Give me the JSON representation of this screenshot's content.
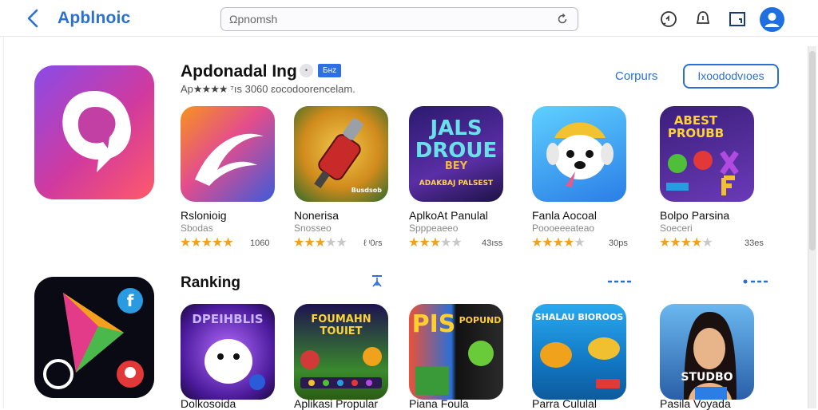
{
  "header": {
    "brand": "Αpblnoic",
    "search_placeholder": "Ωpnomsh"
  },
  "featured": {
    "title": "Apdonadal Ing",
    "badge_gray": "•",
    "badge_blue": "Бнz",
    "subtitle_prefix": "Ap",
    "subtitle_stars": "★★★★",
    "subtitle_rest": "⁷ıs 3060 ɛocodoorencelam.",
    "compare_link": "Corpurs",
    "action_button": "Ixoododvıoes"
  },
  "row1": [
    {
      "name": "Rslonioig",
      "category": "Sbodas",
      "rating": 5,
      "count": "1060"
    },
    {
      "name": "Nonerisa",
      "category": "Snosseo",
      "rating": 3,
      "count": "ℓ ᶦ0ɾs",
      "tile_text": "Busdsob"
    },
    {
      "name": "AplkoAt Panulal",
      "category": "Spppeaeeo",
      "rating": 3,
      "count": "43ıss",
      "tile_text": "JALS DROUE",
      "tile_text2": "BEY",
      "tile_text3": "ADAKBAJ PALSEST"
    },
    {
      "name": "Fanla Aocoal",
      "category": "Poooeeeateao",
      "rating": 4,
      "count": "30ps"
    },
    {
      "name": "Bolpo Parsina",
      "category": "Soeceri",
      "rating": 4,
      "count": "33es",
      "tile_text": "ABEST PROUBB"
    }
  ],
  "ranking": {
    "title": "Ranking"
  },
  "row2": [
    {
      "name": "Dolkosoida",
      "tile_text": "DPEIHBLIS"
    },
    {
      "name": "Aplikasi Propular",
      "tile_text": "FOUMAHN TOUIET"
    },
    {
      "name": "Piana Foula",
      "tile_text": "PIS",
      "tile_text2": "POPUND"
    },
    {
      "name": "Parra Cululal",
      "tile_text": "SHALAU BIOROOS"
    },
    {
      "name": "Pasila Voyada",
      "tile_text": "STUDBO"
    }
  ],
  "colors": {
    "accent": "#2b6fd6",
    "star": "#f0a21c",
    "star_off": "#c8c8c8"
  }
}
